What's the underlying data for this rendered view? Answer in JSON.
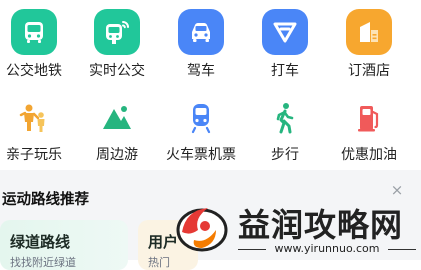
{
  "grid": {
    "row1": [
      {
        "label": "公交地铁",
        "icon": "bus-icon",
        "color": "#21c79a"
      },
      {
        "label": "实时公交",
        "icon": "realtime-bus-icon",
        "color": "#21c79a"
      },
      {
        "label": "驾车",
        "icon": "car-icon",
        "color": "#4a86f7"
      },
      {
        "label": "打车",
        "icon": "taxi-icon",
        "color": "#4a86f7"
      },
      {
        "label": "订酒店",
        "icon": "hotel-icon",
        "color": "#f7a72f"
      }
    ],
    "row2": [
      {
        "label": "亲子玩乐",
        "icon": "family-icon",
        "color": "#f2a532"
      },
      {
        "label": "周边游",
        "icon": "mountain-icon",
        "color": "#26b57f"
      },
      {
        "label": "火车票机票",
        "icon": "train-icon",
        "color": "#4a86f7"
      },
      {
        "label": "步行",
        "icon": "walk-icon",
        "color": "#26b57f"
      },
      {
        "label": "优惠加油",
        "icon": "fuel-icon",
        "color": "#f05a5a"
      }
    ]
  },
  "section": {
    "title": "运动路线推荐",
    "close_label": "×",
    "cards": [
      {
        "title": "绿道路线",
        "subtitle": "找找附近绿道"
      },
      {
        "title": "用户",
        "subtitle": "热门"
      }
    ]
  },
  "watermark": {
    "title": "益润攻略网",
    "url": "www.yirunnuo.com"
  }
}
